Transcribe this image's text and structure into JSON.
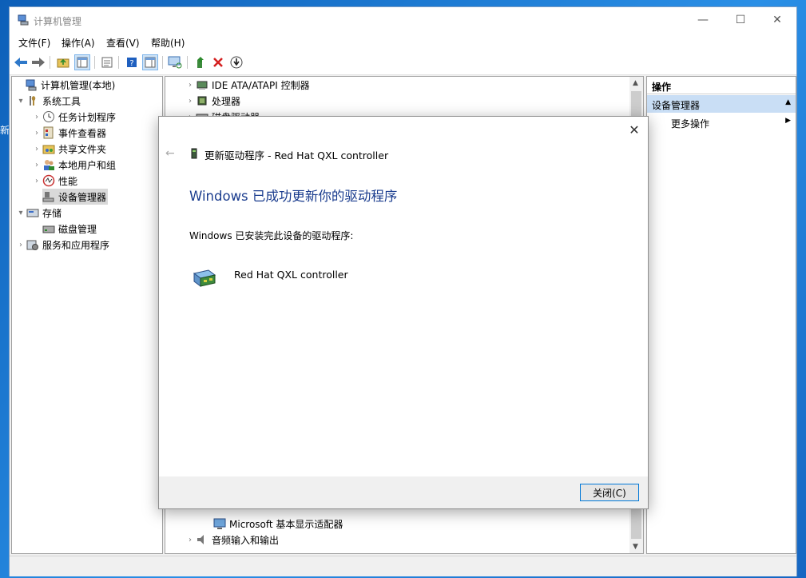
{
  "desktop": {
    "side_text": "新"
  },
  "window": {
    "title": "计算机管理",
    "controls": {
      "minimize": "—",
      "maximize": "☐",
      "close": "✕"
    }
  },
  "menubar": [
    {
      "label": "文件(F)"
    },
    {
      "label": "操作(A)"
    },
    {
      "label": "查看(V)"
    },
    {
      "label": "帮助(H)"
    }
  ],
  "tree": {
    "root": "计算机管理(本地)",
    "system_tools": "系统工具",
    "items": [
      {
        "label": "任务计划程序",
        "icon": "clock-icon"
      },
      {
        "label": "事件查看器",
        "icon": "event-viewer-icon"
      },
      {
        "label": "共享文件夹",
        "icon": "shared-folder-icon"
      },
      {
        "label": "本地用户和组",
        "icon": "users-icon"
      },
      {
        "label": "性能",
        "icon": "performance-icon"
      },
      {
        "label": "设备管理器",
        "icon": "device-manager-icon"
      }
    ],
    "storage": "存储",
    "disk_mgmt": "磁盘管理",
    "services": "服务和应用程序"
  },
  "devices": {
    "top": [
      {
        "label": "IDE ATA/ATAPI 控制器"
      },
      {
        "label": "处理器"
      },
      {
        "label": "磁盘驱动器"
      }
    ],
    "bottom": [
      {
        "label": "Microsoft 基本显示适配器"
      },
      {
        "label": "音频输入和输出"
      }
    ]
  },
  "actions": {
    "header": "操作",
    "selected": "设备管理器",
    "more": "更多操作"
  },
  "dialog": {
    "title": "更新驱动程序 - Red Hat QXL controller",
    "heading": "Windows 已成功更新你的驱动程序",
    "body": "Windows 已安装完此设备的驱动程序:",
    "device": "Red Hat QXL controller",
    "close_button": "关闭(C)",
    "close_x": "✕",
    "back": "←"
  },
  "colors": {
    "accent": "#0078d7",
    "heading": "#1a3c8e",
    "selection": "#c9def5"
  }
}
